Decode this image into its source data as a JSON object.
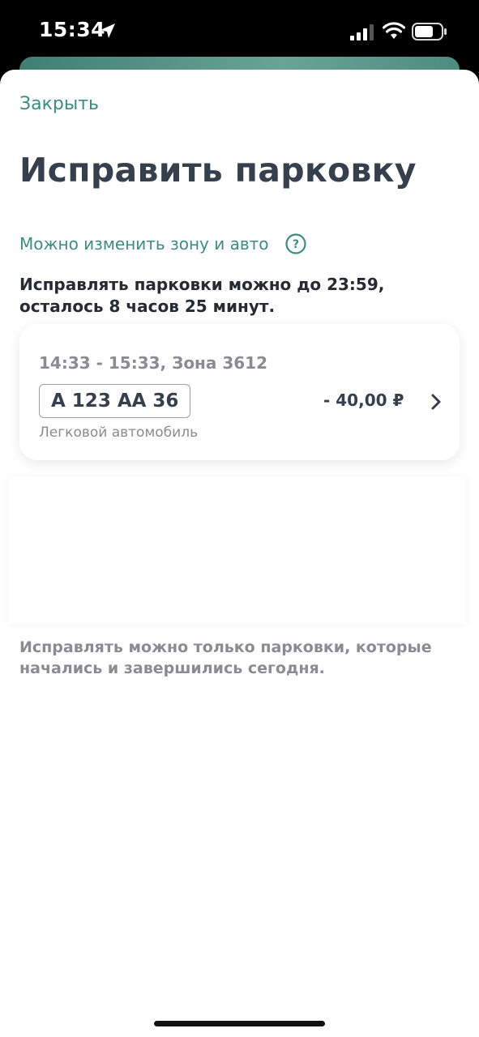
{
  "status_bar": {
    "time": "15:34"
  },
  "sheet": {
    "close_label": "Закрыть",
    "title": "Исправить парковку",
    "hint": "Можно изменить зону и авто",
    "deadline_text": "Исправлять парковки можно до 23:59, осталось 8 часов 25 минут.",
    "parking": {
      "interval": "14:33 - 15:33, Зона 3612",
      "plate": "А 123 АА 36",
      "vehicle_type": "Легковой автомобиль",
      "price": "- 40,00 ₽"
    },
    "footnote": "Исправлять можно только парковки, которые начались и завершились сегодня."
  },
  "colors": {
    "accent": "#3d8c7c",
    "title": "#363f4c",
    "muted": "#8a8c91"
  },
  "icons": [
    "location-arrow-icon",
    "cellular-signal-icon",
    "wifi-icon",
    "battery-icon",
    "help-icon",
    "chevron-right-icon"
  ]
}
